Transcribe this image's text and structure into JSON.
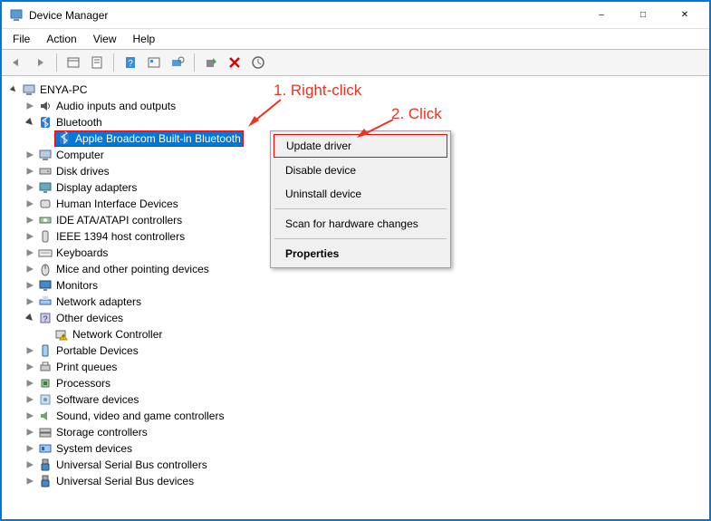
{
  "window": {
    "title": "Device Manager"
  },
  "menu": {
    "file": "File",
    "action": "Action",
    "view": "View",
    "help": "Help"
  },
  "tree": {
    "root": "ENYA-PC",
    "items": [
      {
        "label": "Audio inputs and outputs",
        "icon": "audio"
      },
      {
        "label": "Bluetooth",
        "icon": "bluetooth",
        "expanded": true,
        "children": [
          {
            "label": "Apple Broadcom Built-in Bluetooth",
            "icon": "bluetooth",
            "selected": true
          }
        ]
      },
      {
        "label": "Computer",
        "icon": "computer"
      },
      {
        "label": "Disk drives",
        "icon": "disk"
      },
      {
        "label": "Display adapters",
        "icon": "display"
      },
      {
        "label": "Human Interface Devices",
        "icon": "hid"
      },
      {
        "label": "IDE ATA/ATAPI controllers",
        "icon": "ide"
      },
      {
        "label": "IEEE 1394 host controllers",
        "icon": "ieee"
      },
      {
        "label": "Keyboards",
        "icon": "keyboard"
      },
      {
        "label": "Mice and other pointing devices",
        "icon": "mouse"
      },
      {
        "label": "Monitors",
        "icon": "monitor"
      },
      {
        "label": "Network adapters",
        "icon": "network"
      },
      {
        "label": "Other devices",
        "icon": "other",
        "expanded": true,
        "children": [
          {
            "label": "Network Controller",
            "icon": "warn"
          }
        ]
      },
      {
        "label": "Portable Devices",
        "icon": "portable"
      },
      {
        "label": "Print queues",
        "icon": "print"
      },
      {
        "label": "Processors",
        "icon": "cpu"
      },
      {
        "label": "Software devices",
        "icon": "software"
      },
      {
        "label": "Sound, video and game controllers",
        "icon": "sound"
      },
      {
        "label": "Storage controllers",
        "icon": "storage"
      },
      {
        "label": "System devices",
        "icon": "system"
      },
      {
        "label": "Universal Serial Bus controllers",
        "icon": "usb"
      },
      {
        "label": "Universal Serial Bus devices",
        "icon": "usb"
      }
    ]
  },
  "context_menu": {
    "update": "Update driver",
    "disable": "Disable device",
    "uninstall": "Uninstall device",
    "scan": "Scan for hardware changes",
    "properties": "Properties"
  },
  "annotations": {
    "step1": "1. Right-click",
    "step2": "2. Click"
  }
}
